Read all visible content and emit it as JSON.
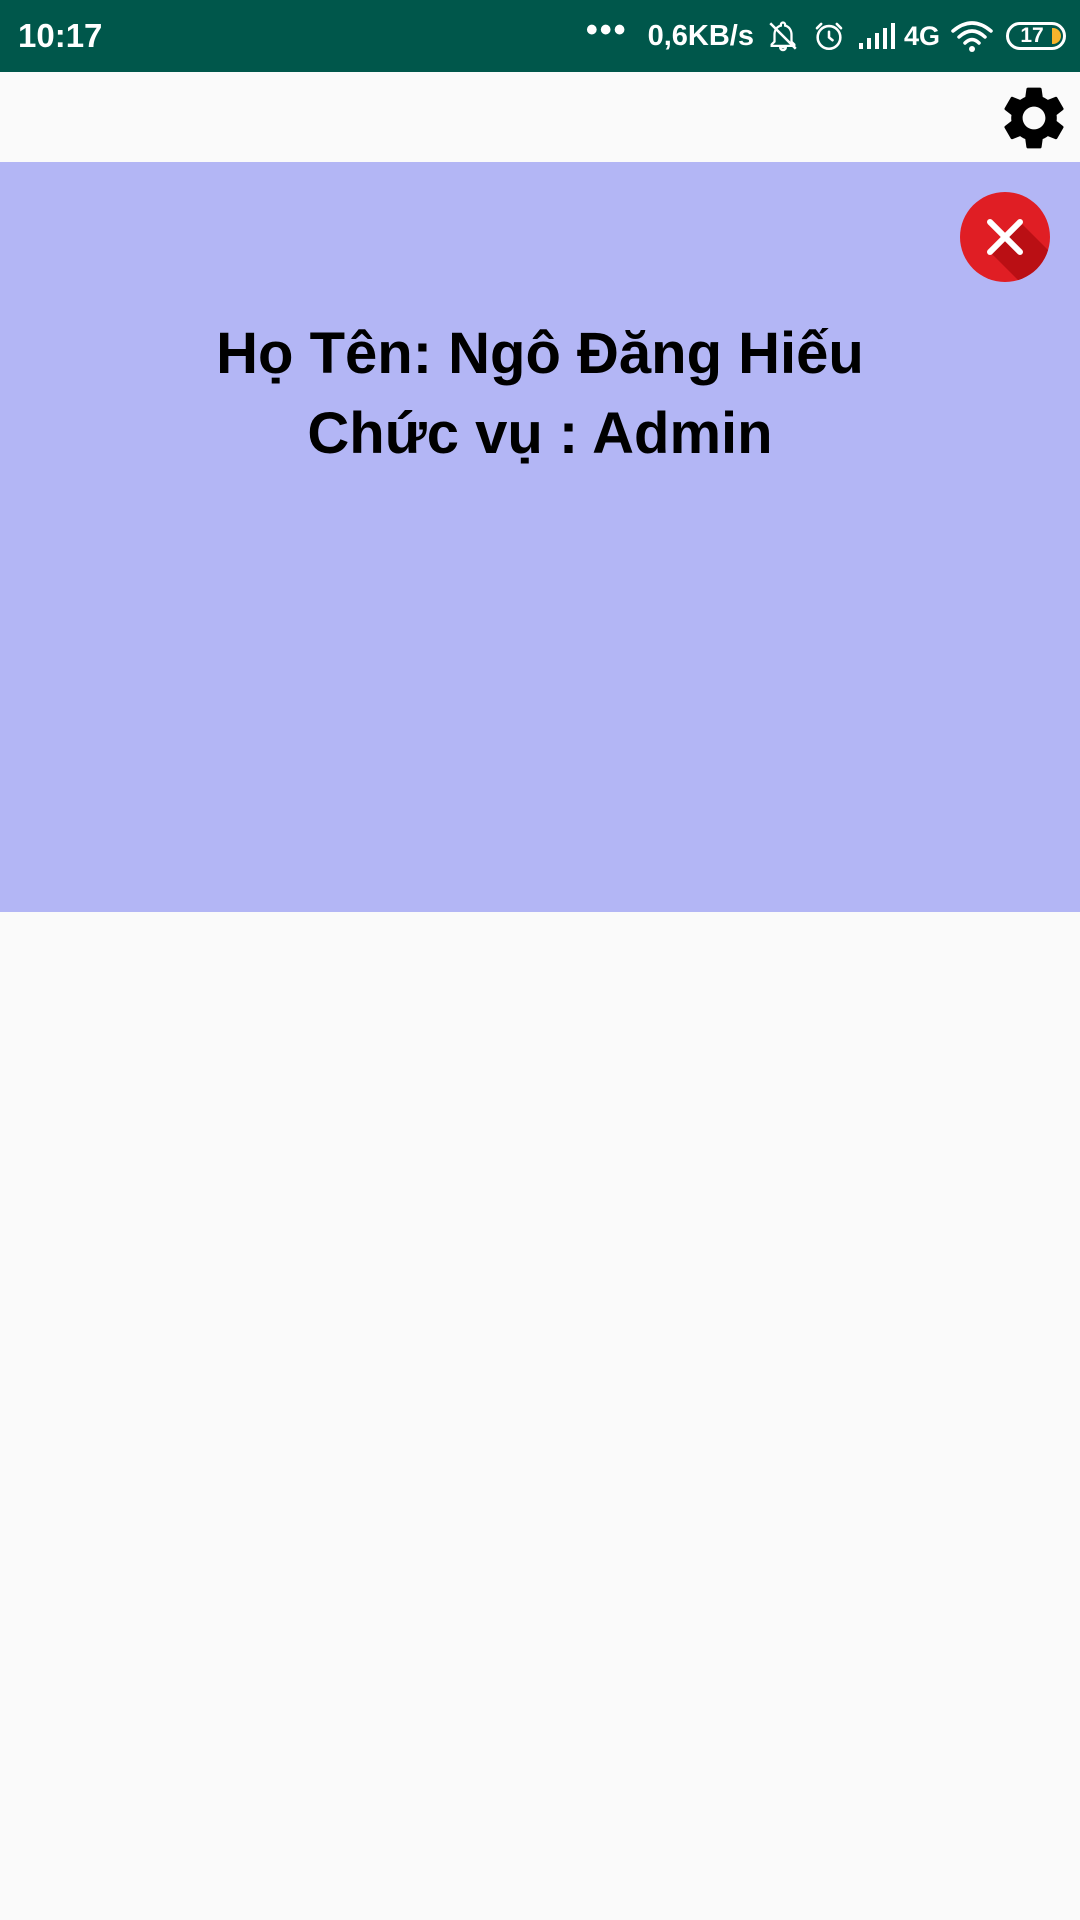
{
  "status_bar": {
    "time": "10:17",
    "more_indicator": "•••",
    "net_speed": "0,6KB/s",
    "network_type": "4G",
    "battery_level": "17",
    "icons": [
      "notifications-muted-icon",
      "alarm-icon",
      "signal-icon",
      "wifi-icon",
      "battery-icon"
    ],
    "background_color": "#00574b"
  },
  "app_bar": {
    "settings_icon": "gear-icon"
  },
  "profile": {
    "name_line": "Họ Tên: Ngô Đăng Hiếu",
    "role_line": "Chức vụ : Admin",
    "panel_color": "#b3b6f5",
    "close_icon": "close-icon",
    "close_color": "#e01e24"
  }
}
